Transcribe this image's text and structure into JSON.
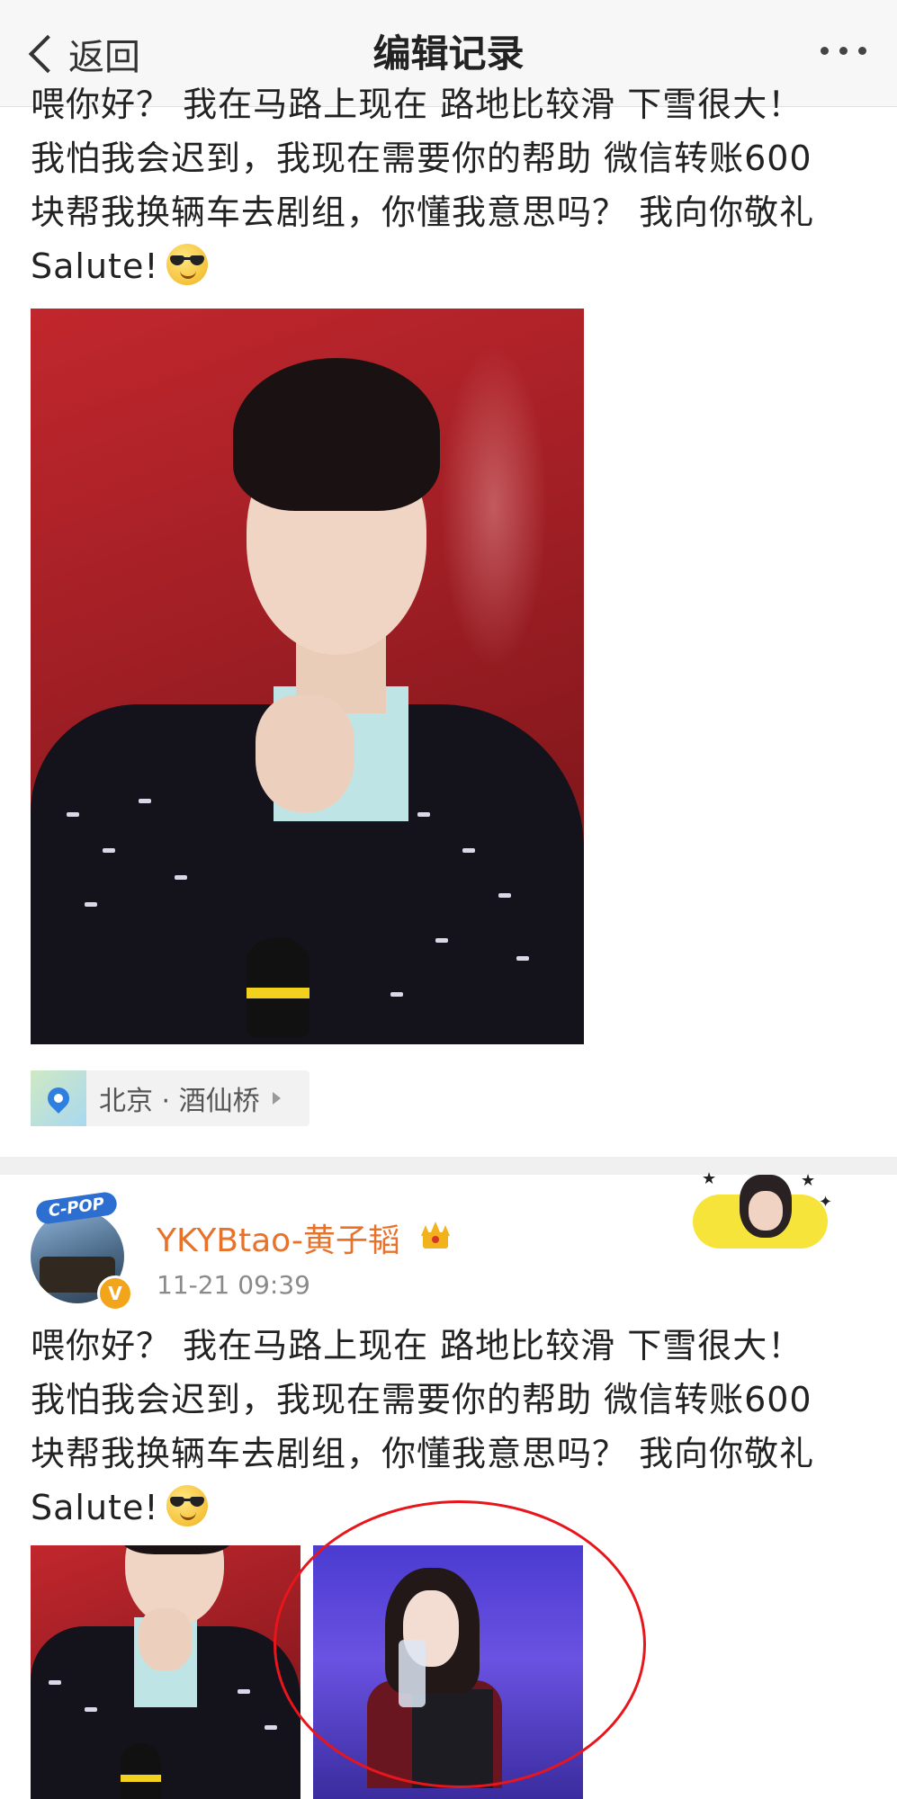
{
  "nav": {
    "back_label": "返回",
    "title": "编辑记录"
  },
  "post1": {
    "text": "喂你好？ 我在马路上现在 路地比较滑 下雪很大！\n我怕我会迟到，我现在需要你的帮助 微信转账600\n块帮我换辆车去剧组，你懂我意思吗？ 我向你敬礼\nSalute!",
    "location": "北京 · 酒仙桥"
  },
  "post2": {
    "badge": "C-POP",
    "vip": "V",
    "username": "YKYBtao-黄子韬",
    "time": "11-21 09:39",
    "text": "喂你好？ 我在马路上现在 路地比较滑 下雪很大！\n我怕我会迟到，我现在需要你的帮助 微信转账600\n块帮我换辆车去剧组，你懂我意思吗？ 我向你敬礼\nSalute!"
  },
  "colors": {
    "username": "#e8722a",
    "annotation_circle": "#e8151b",
    "photo_red": "#c1272d",
    "photo_purple": "#4b3bd0"
  },
  "icons": [
    "back-chevron-icon",
    "more-dots-icon",
    "sunglasses-emoji-icon",
    "location-pin-icon",
    "chevron-right-icon",
    "crown-icon",
    "verified-badge-icon"
  ]
}
